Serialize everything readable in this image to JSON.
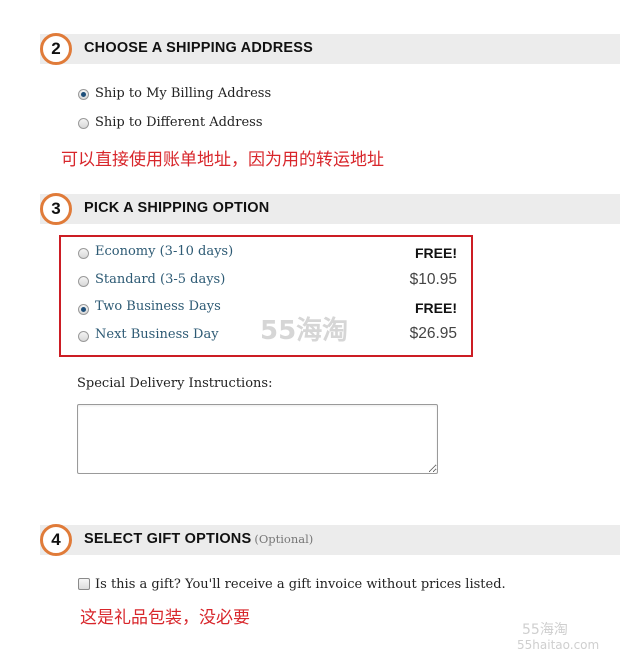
{
  "shipping_address": {
    "step": "2",
    "title": "CHOOSE A SHIPPING ADDRESS",
    "options": [
      {
        "label": "Ship to My Billing Address",
        "checked": true
      },
      {
        "label": "Ship to Different Address",
        "checked": false
      }
    ],
    "annotation": "可以直接使用账单地址，因为用的转运地址"
  },
  "shipping_option": {
    "step": "3",
    "title": "PICK A SHIPPING OPTION",
    "options": [
      {
        "label": "Economy (3-10 days)",
        "price": "FREE!",
        "checked": false
      },
      {
        "label": "Standard (3-5 days)",
        "price": "$10.95",
        "checked": false
      },
      {
        "label": "Two Business Days",
        "price": "FREE!",
        "checked": true
      },
      {
        "label": "Next Business Day",
        "price": "$26.95",
        "checked": false
      }
    ],
    "watermark": "55海淘",
    "instructions_label": "Special Delivery Instructions:",
    "instructions_value": ""
  },
  "gift_options": {
    "step": "4",
    "title": "SELECT GIFT OPTIONS",
    "optional_tag": "(Optional)",
    "gift_checkbox_label": "Is this a gift? You'll receive a gift invoice without prices listed.",
    "gift_checked": false,
    "annotation": "这是礼品包装，没必要"
  },
  "corner_watermark": {
    "line1": "55海淘",
    "line2": "55haitao.com"
  },
  "colors": {
    "step_ring": "#e07b39",
    "header_bg": "#ececec",
    "annotation_red": "#d8262b",
    "highlight_box": "#cc1d24",
    "link_blue": "#2d5a74"
  }
}
